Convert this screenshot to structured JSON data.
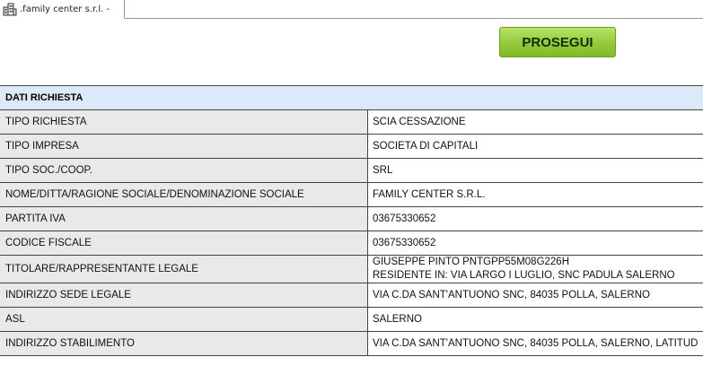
{
  "tab": {
    "label": ".family center s.r.l. -",
    "icon": "building-icon"
  },
  "actions": {
    "prosegui_label": "PROSEGUI",
    "accent": "#94c93a"
  },
  "section": {
    "title": "DATI RICHIESTA",
    "header_color": "#dbe9f8"
  },
  "rows": [
    {
      "label": "TIPO RICHIESTA",
      "values": [
        "SCIA CESSAZIONE"
      ]
    },
    {
      "label": "TIPO IMPRESA",
      "values": [
        "SOCIETA DI CAPITALI"
      ]
    },
    {
      "label": "TIPO SOC./COOP.",
      "values": [
        "SRL"
      ]
    },
    {
      "label": "NOME/DITTA/RAGIONE SOCIALE/DENOMINAZIONE SOCIALE",
      "values": [
        "FAMILY CENTER S.R.L."
      ]
    },
    {
      "label": "PARTITA IVA",
      "values": [
        "03675330652"
      ]
    },
    {
      "label": "CODICE FISCALE",
      "values": [
        "03675330652"
      ]
    },
    {
      "label": "TITOLARE/RAPPRESENTANTE LEGALE",
      "values": [
        "GIUSEPPE PINTO PNTGPP55M08G226H",
        "RESIDENTE IN: VIA LARGO I LUGLIO, SNC PADULA SALERNO"
      ]
    },
    {
      "label": "INDIRIZZO SEDE LEGALE",
      "values": [
        "VIA C.DA SANT'ANTUONO SNC, 84035 POLLA, SALERNO"
      ]
    },
    {
      "label": "ASL",
      "values": [
        "SALERNO"
      ]
    },
    {
      "label": "INDIRIZZO STABILIMENTO",
      "values": [
        "VIA C.DA SANT'ANTUONO SNC, 84035 POLLA, SALERNO, LATITUD"
      ]
    }
  ]
}
